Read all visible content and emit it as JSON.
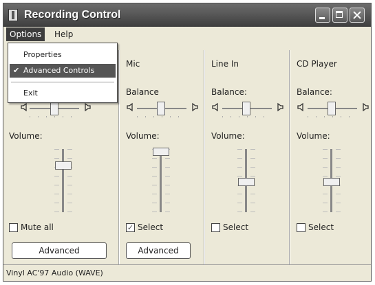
{
  "window": {
    "title": "Recording Control"
  },
  "menubar": {
    "options": "Options",
    "help": "Help"
  },
  "dropdown": {
    "properties": "Properties",
    "advanced_controls": "Advanced Controls",
    "check": "✔",
    "exit": "Exit"
  },
  "columns": [
    {
      "name": "",
      "balance": "",
      "volume": "Volume:",
      "volume_level": 0.75,
      "checkbox_label": "Mute all",
      "checked": false,
      "advanced": "Advanced"
    },
    {
      "name": "Mic",
      "balance": "Balance",
      "volume": "Volume:",
      "volume_level": 1.0,
      "checkbox_label": "Select",
      "checked": true,
      "advanced": "Advanced"
    },
    {
      "name": "Line In",
      "balance": "Balance:",
      "volume": "Volume:",
      "volume_level": 0.45,
      "checkbox_label": "Select",
      "checked": false
    },
    {
      "name": "CD Player",
      "balance": "Balance:",
      "volume": "Volume:",
      "volume_level": 0.45,
      "checkbox_label": "Select",
      "checked": false
    }
  ],
  "status": {
    "text": "Vinyl AC'97 Audio (WAVE)"
  },
  "icons": {
    "app": "app-icon",
    "speaker": "speaker-icon"
  }
}
